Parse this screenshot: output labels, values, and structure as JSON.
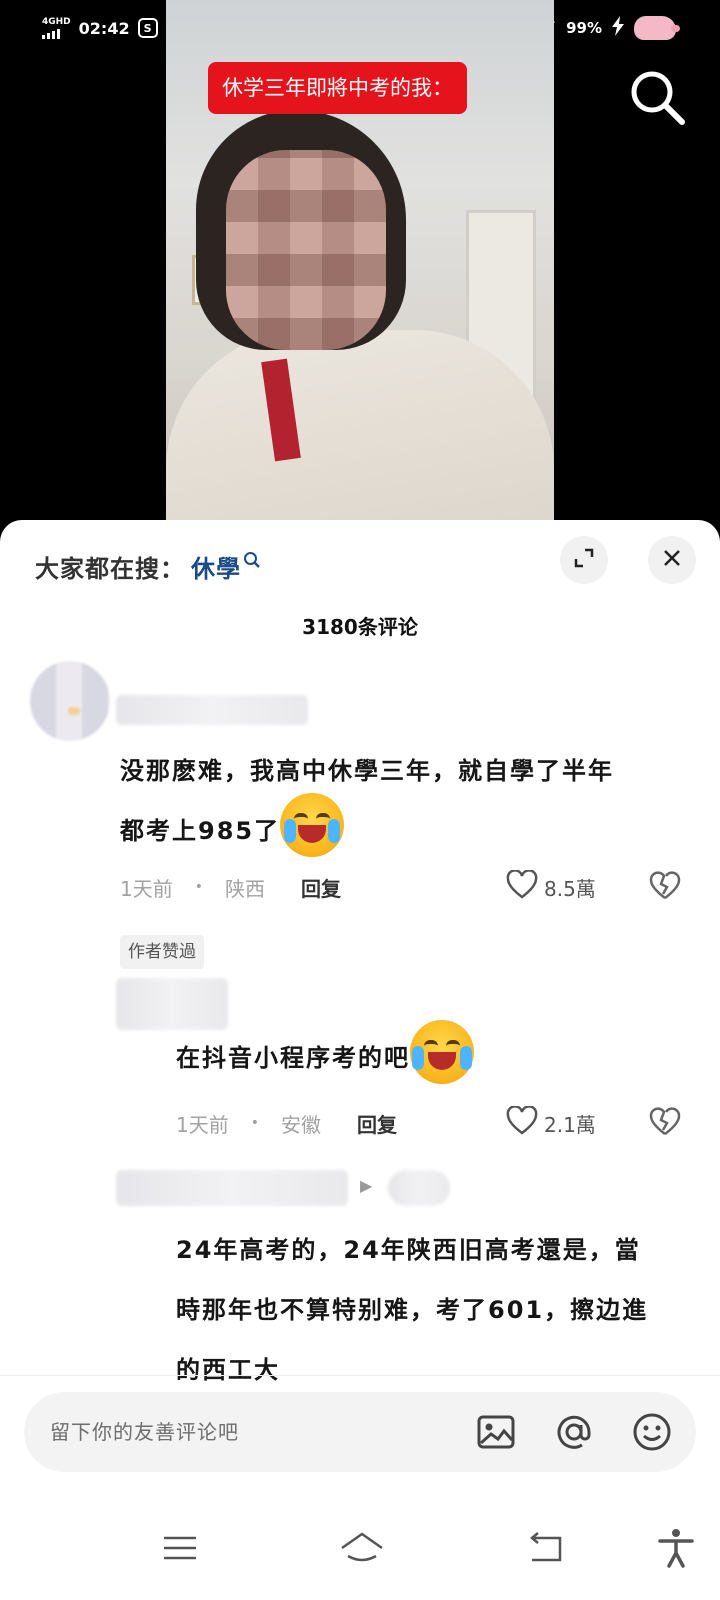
{
  "status_bar": {
    "network": "4GHD",
    "time": "02:42",
    "battery": "99%",
    "app_icons": [
      "s-icon",
      "bank-icon",
      "taobao-icon",
      "weibo-icon"
    ],
    "right_icons": [
      "alarm-icon",
      "mute-icon",
      "wifi-icon",
      "charging-icon"
    ]
  },
  "video": {
    "caption": "休学三年即將中考的我："
  },
  "comments_panel": {
    "hot_search_label": "大家都在搜：",
    "hot_search_term": "休學",
    "comment_count": "3180条评论",
    "comments": [
      {
        "text_line1": "没那麽难，我高中休學三年，就自學了半年",
        "text_line2": "都考上985了",
        "time": "1天前",
        "location": "陕西",
        "reply": "回复",
        "likes": "8.5萬",
        "badge": "作者赞過"
      },
      {
        "text": "在抖音小程序考的吧",
        "time": "1天前",
        "location": "安徽",
        "reply": "回复",
        "likes": "2.1萬"
      },
      {
        "text_line1": "24年高考的，24年陕西旧高考還是，當",
        "text_line2": "時那年也不算特别难，考了601，擦边進",
        "text_line3": "的西工大"
      }
    ]
  },
  "input_bar": {
    "placeholder": "留下你的友善评论吧"
  },
  "colors": {
    "caption_red": "#e4131c",
    "hot_search_blue": "#1c4a86"
  }
}
